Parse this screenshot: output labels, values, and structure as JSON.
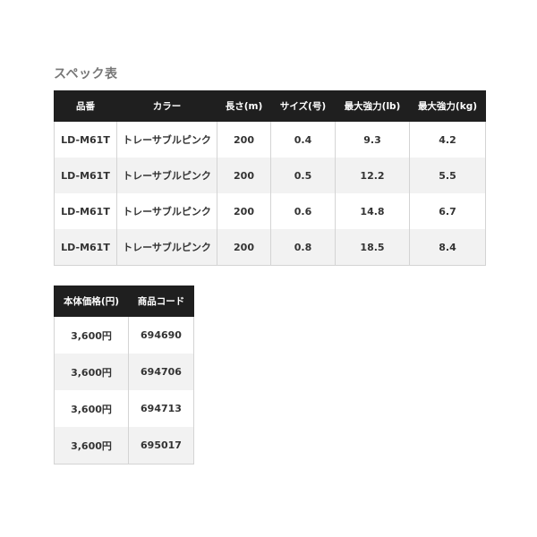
{
  "heading": "スペック表",
  "spec_table": {
    "headers": [
      "品番",
      "カラー",
      "長さ(m)",
      "サイズ(号)",
      "最大強力(lb)",
      "最大強力(kg)"
    ],
    "rows": [
      [
        "LD-M61T",
        "トレーサブルピンク",
        "200",
        "0.4",
        "9.3",
        "4.2"
      ],
      [
        "LD-M61T",
        "トレーサブルピンク",
        "200",
        "0.5",
        "12.2",
        "5.5"
      ],
      [
        "LD-M61T",
        "トレーサブルピンク",
        "200",
        "0.6",
        "14.8",
        "6.7"
      ],
      [
        "LD-M61T",
        "トレーサブルピンク",
        "200",
        "0.8",
        "18.5",
        "8.4"
      ]
    ]
  },
  "price_table": {
    "headers": [
      "本体価格(円)",
      "商品コード"
    ],
    "rows": [
      [
        "3,600円",
        "694690"
      ],
      [
        "3,600円",
        "694706"
      ],
      [
        "3,600円",
        "694713"
      ],
      [
        "3,600円",
        "695017"
      ]
    ]
  }
}
